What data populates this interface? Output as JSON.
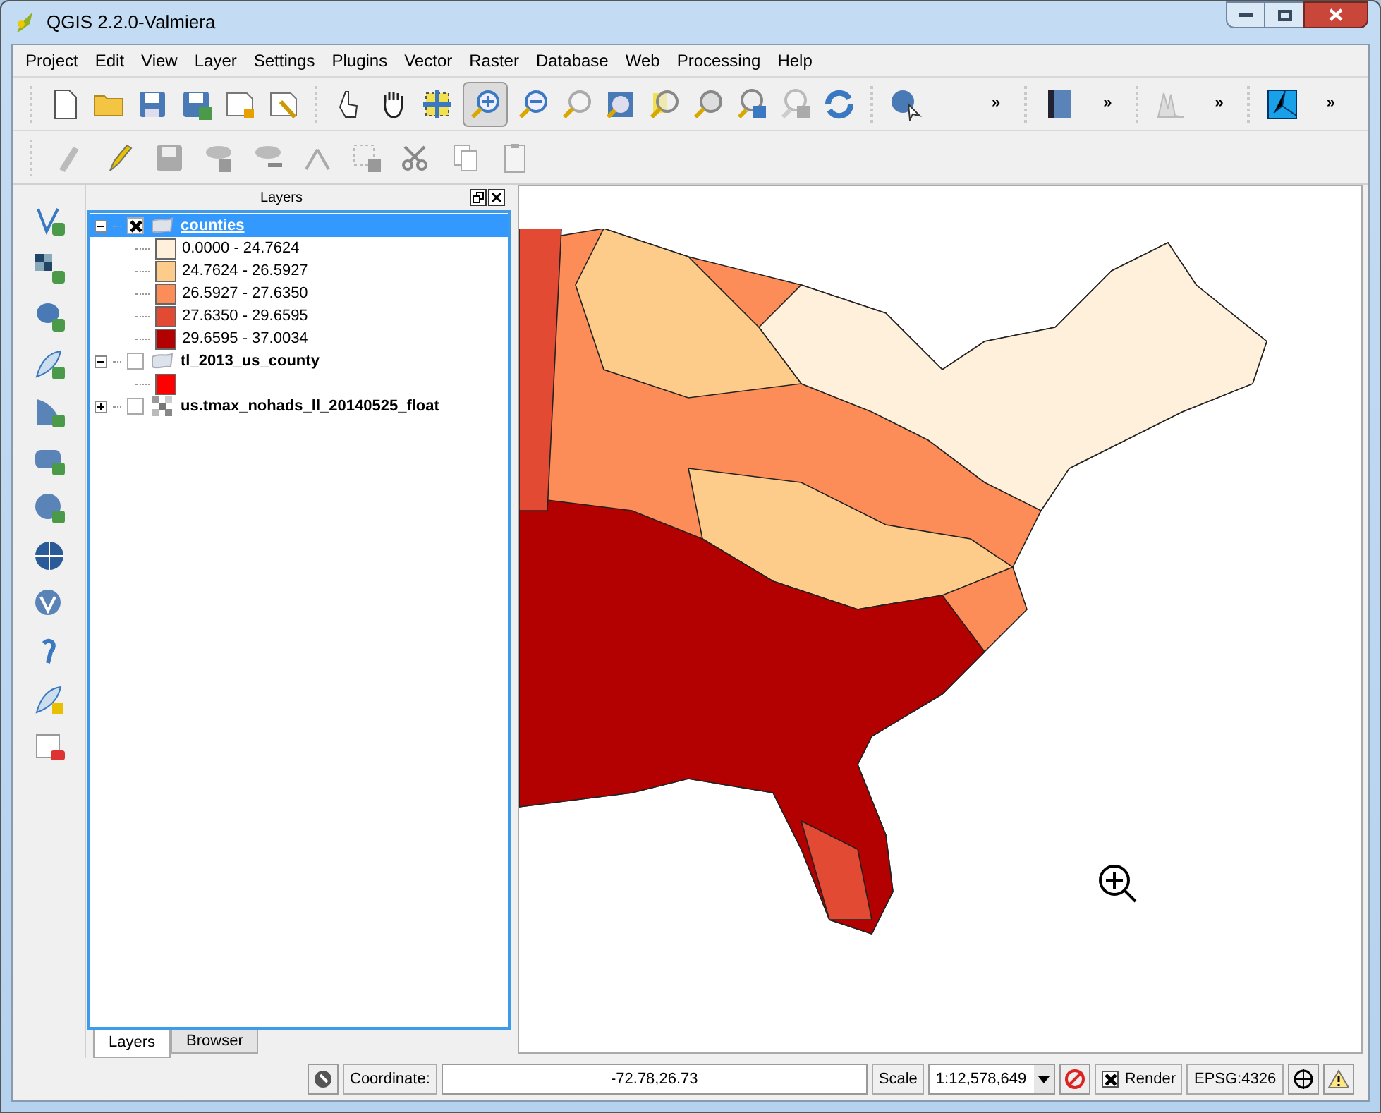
{
  "window": {
    "title": "QGIS 2.2.0-Valmiera"
  },
  "menu": [
    "Project",
    "Edit",
    "View",
    "Layer",
    "Settings",
    "Plugins",
    "Vector",
    "Raster",
    "Database",
    "Web",
    "Processing",
    "Help"
  ],
  "toolbar_overflow": [
    "»",
    "»",
    "»",
    "»"
  ],
  "layers_panel": {
    "title": "Layers",
    "layers": [
      {
        "name": "counties",
        "kind": "vector",
        "checked": true,
        "expanded": true,
        "selected": true,
        "legend": [
          {
            "label": "0.0000 - 24.7624",
            "color": "#fff0dc"
          },
          {
            "label": "24.7624 - 26.5927",
            "color": "#fdcc8a"
          },
          {
            "label": "26.5927 - 27.6350",
            "color": "#fc8d59"
          },
          {
            "label": "27.6350 - 29.6595",
            "color": "#e34a33"
          },
          {
            "label": "29.6595 - 37.0034",
            "color": "#b30000"
          }
        ]
      },
      {
        "name": "tl_2013_us_county",
        "kind": "vector",
        "checked": false,
        "expanded": true,
        "selected": false,
        "legend": [
          {
            "color": "#ff0000"
          }
        ]
      },
      {
        "name": "us.tmax_nohads_ll_20140525_float",
        "kind": "raster",
        "checked": false,
        "expanded": false,
        "selected": false
      }
    ]
  },
  "panel_tabs": [
    {
      "label": "Layers",
      "selected": true
    },
    {
      "label": "Browser",
      "selected": false
    }
  ],
  "status_bar": {
    "coordinate_label": "Coordinate:",
    "coordinate": "-72.78,26.73",
    "scale_label": "Scale",
    "scale": "1:12,578,649",
    "render_label": "Render",
    "render_checked": true,
    "crs": "EPSG:4326"
  }
}
